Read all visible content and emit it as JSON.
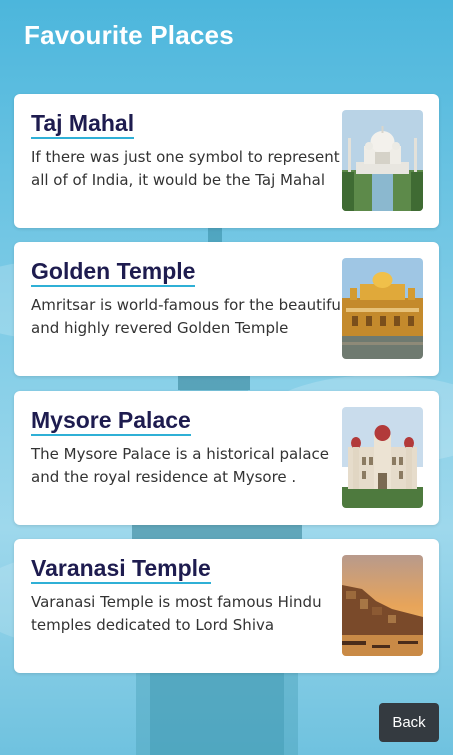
{
  "header": {
    "title": "Favourite Places"
  },
  "places": [
    {
      "title": "Taj Mahal",
      "description": "If there was just one symbol to represent all of of India, it would be the Taj Mahal",
      "image_icon": "taj-mahal-image"
    },
    {
      "title": "Golden Temple",
      "description": "Amritsar is world-famous for the beautiful and highly revered Golden Temple",
      "image_icon": "golden-temple-image"
    },
    {
      "title": "Mysore Palace",
      "description": "The Mysore Palace is a historical palace and the royal residence at Mysore .",
      "image_icon": "mysore-palace-image"
    },
    {
      "title": "Varanasi Temple",
      "description": "Varanasi Temple is most famous Hindu temples dedicated to Lord Shiva",
      "image_icon": "varanasi-ghats-image"
    }
  ],
  "footer": {
    "back_label": "Back"
  },
  "colors": {
    "title_text": "#1e1c4f",
    "title_underline": "#2fb0d6",
    "back_button": "#343a40",
    "sky": "#4cb6dc"
  }
}
